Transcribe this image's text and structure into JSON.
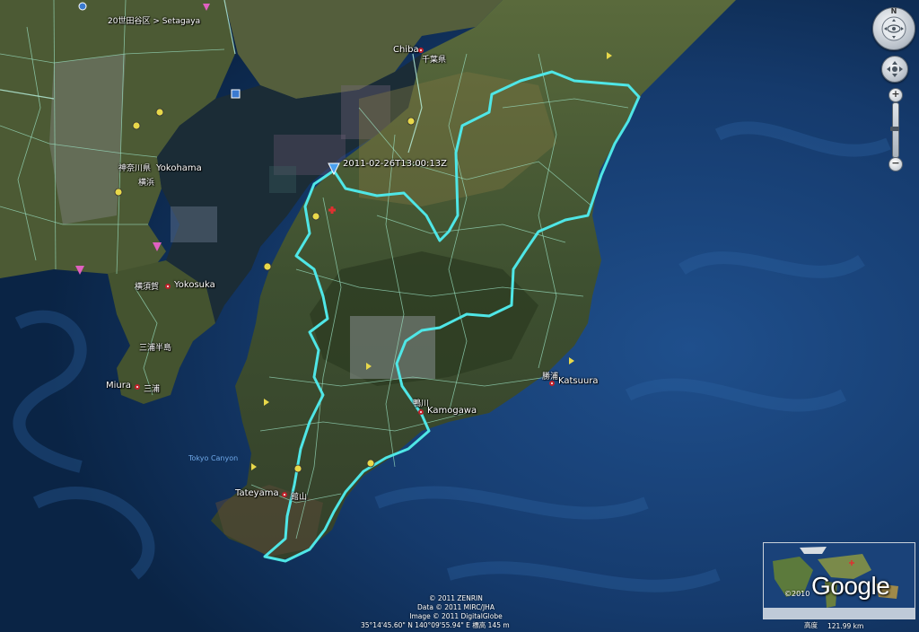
{
  "colors": {
    "ocean": "#0c2342",
    "land": "#3b4a2c",
    "track": "#4fe6e6",
    "roads": "#9adfc0",
    "bay": "#1d2e3a"
  },
  "map": {
    "breadcrumb": "20世田谷区 > Setagaya",
    "track_timestamp": "2011-02-26T13:00:13Z",
    "places": {
      "chiba": "Chiba",
      "chiba_jp": "千葉県",
      "kanagawa_jp": "神奈川県",
      "yokohama": "Yokohama",
      "yokohama_jp": "横浜",
      "yokosuka_jp": "横須賀",
      "yokosuka": "Yokosuka",
      "miura_hanto_jp": "三浦半島",
      "miura": "Miura",
      "miura_jp": "三浦",
      "tateyama": "Tateyama",
      "tateyama_jp": "館山",
      "kamogawa_jp": "鴨川",
      "kamogawa": "Kamogawa",
      "katsuura_jp": "勝浦",
      "katsuura": "Katsuura",
      "tokyo_canyon": "Tokyo Canyon"
    }
  },
  "nav": {
    "north_label": "N",
    "zoom_in_label": "+",
    "zoom_out_label": "−"
  },
  "overview": {
    "year": "©2010",
    "logo": "Google"
  },
  "credits": {
    "line1": "© 2011 ZENRIN",
    "line2": "Data © 2011 MIRC/JHA",
    "line3": "Image © 2011 DigitalGlobe"
  },
  "status": {
    "coordinates": "35°14'45.60\" N   140°09'55.94\" E   標高  145 m",
    "eye_alt_label": "高度",
    "eye_alt_value": "121.99 km"
  }
}
